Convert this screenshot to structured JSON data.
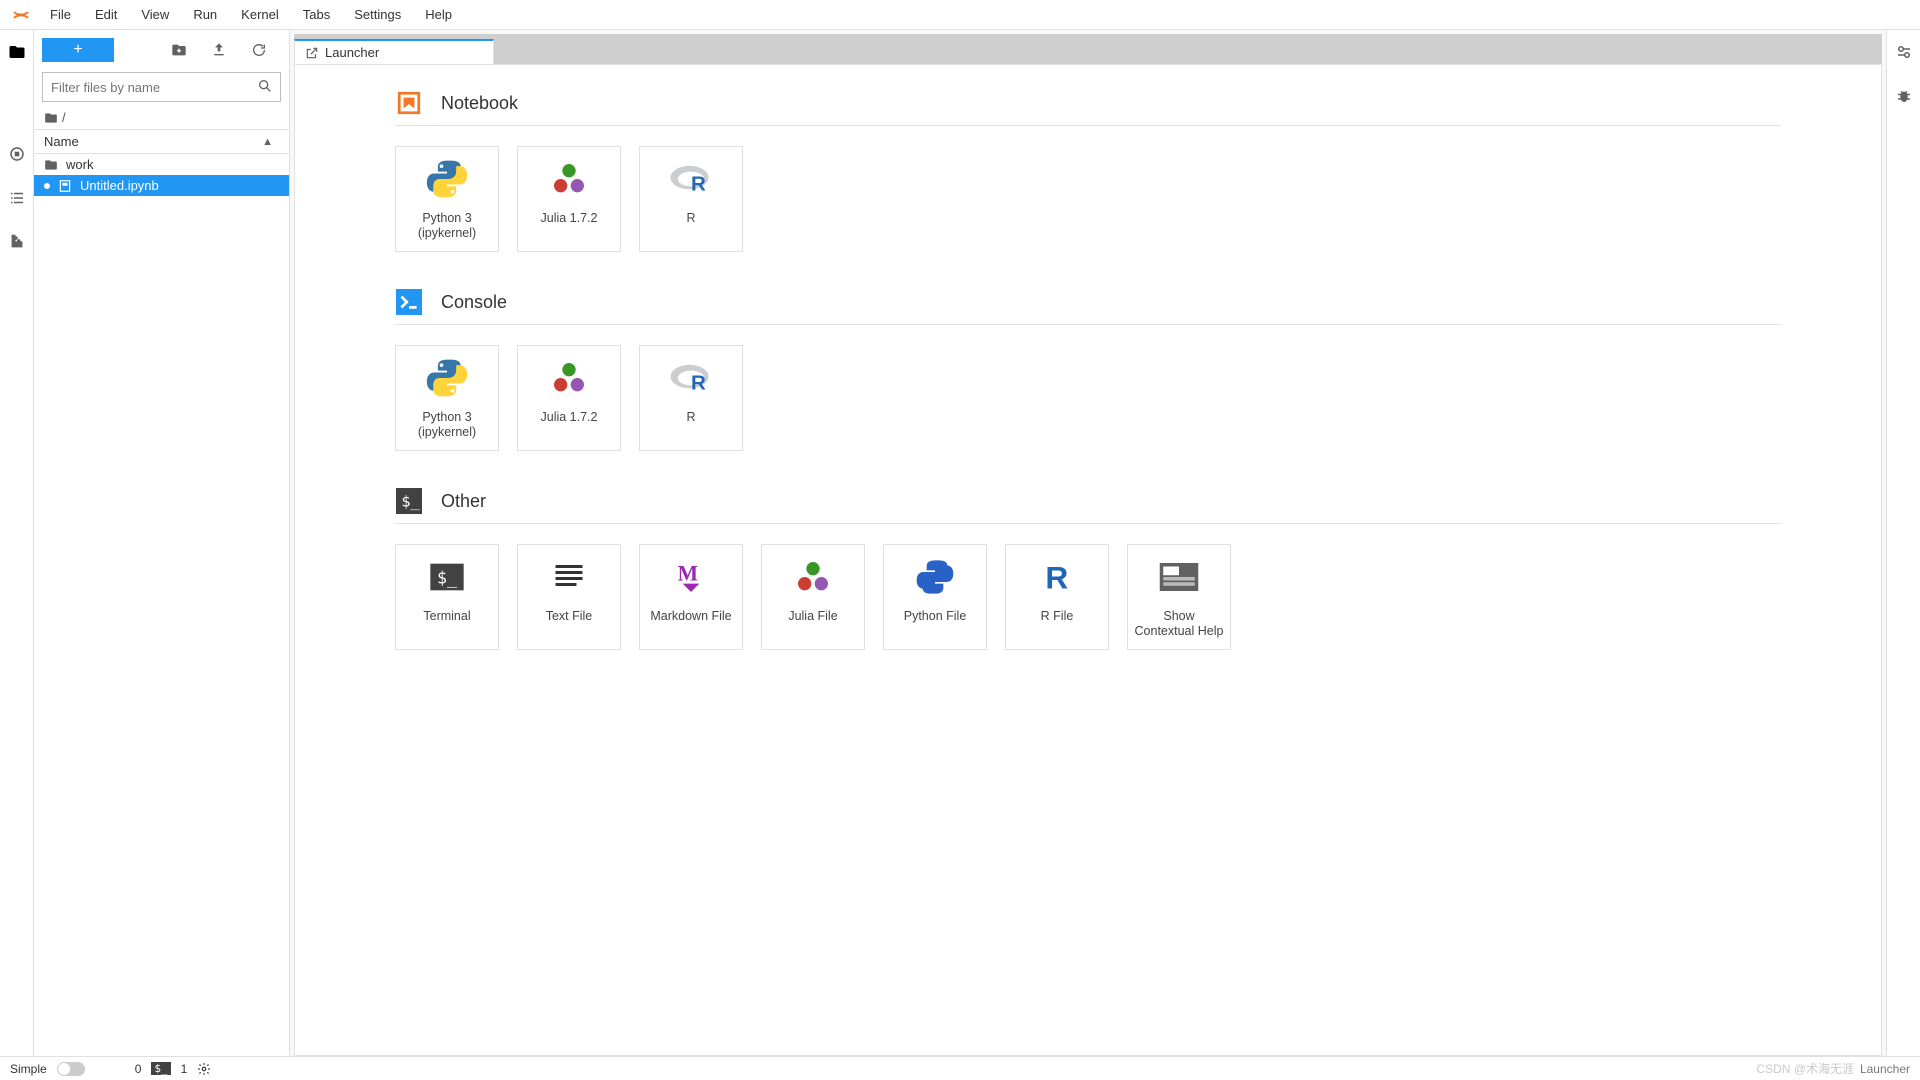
{
  "menu": [
    "File",
    "Edit",
    "View",
    "Run",
    "Kernel",
    "Tabs",
    "Settings",
    "Help"
  ],
  "sidebar": {
    "filter_placeholder": "Filter files by name",
    "breadcrumb_sep": "/",
    "header_name": "Name",
    "items": [
      {
        "kind": "folder",
        "label": "work",
        "selected": false
      },
      {
        "kind": "notebook",
        "label": "Untitled.ipynb",
        "selected": true,
        "modified": true
      }
    ]
  },
  "tab": {
    "title": "Launcher"
  },
  "launcher": {
    "sections": [
      {
        "title": "Notebook",
        "icon": "notebook-icon",
        "icon_color": "#f37726",
        "cards": [
          {
            "label": "Python 3 (ipykernel)",
            "icon": "python"
          },
          {
            "label": "Julia 1.7.2",
            "icon": "julia"
          },
          {
            "label": "R",
            "icon": "r"
          }
        ]
      },
      {
        "title": "Console",
        "icon": "console-icon",
        "icon_color": "#2196f3",
        "cards": [
          {
            "label": "Python 3 (ipykernel)",
            "icon": "python"
          },
          {
            "label": "Julia 1.7.2",
            "icon": "julia"
          },
          {
            "label": "R",
            "icon": "r"
          }
        ]
      },
      {
        "title": "Other",
        "icon": "terminal-icon",
        "icon_color": "#424242",
        "cards": [
          {
            "label": "Terminal",
            "icon": "terminal"
          },
          {
            "label": "Text File",
            "icon": "textfile"
          },
          {
            "label": "Markdown File",
            "icon": "markdown"
          },
          {
            "label": "Julia File",
            "icon": "julia"
          },
          {
            "label": "Python File",
            "icon": "python-flat"
          },
          {
            "label": "R File",
            "icon": "r-flat"
          },
          {
            "label": "Show Contextual Help",
            "icon": "contexthelp"
          }
        ]
      }
    ]
  },
  "status": {
    "simple_label": "Simple",
    "counter_0": "0",
    "counter_1": "1",
    "right_label": "Launcher",
    "watermark": "CSDN @术海无涯"
  }
}
